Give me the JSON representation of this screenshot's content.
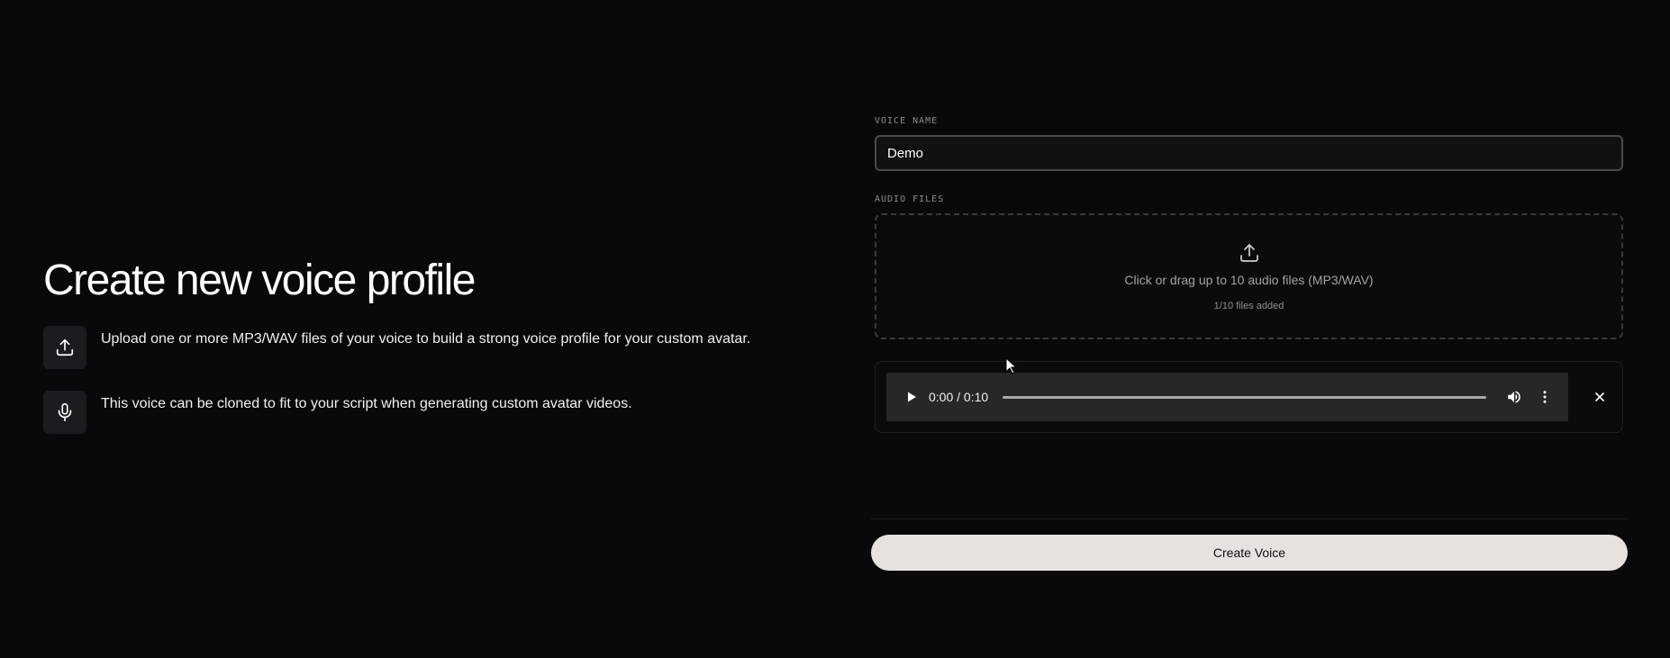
{
  "left": {
    "title": "Create new voice profile",
    "features": [
      {
        "icon": "upload-icon",
        "text": "Upload one or more MP3/WAV files of your voice to build a strong voice profile for your custom avatar."
      },
      {
        "icon": "microphone-icon",
        "text": "This voice can be cloned to fit to your script when generating custom avatar videos."
      }
    ]
  },
  "form": {
    "voice_name_label": "VOICE NAME",
    "voice_name_value": "Demo",
    "audio_files_label": "AUDIO FILES",
    "dropzone_text": "Click or drag up to 10 audio files (MP3/WAV)",
    "dropzone_count": "1/10 files added",
    "dropzone_icon": "upload-icon"
  },
  "audio_player": {
    "time": "0:00 / 0:10",
    "progress": 0,
    "icons": [
      "play-icon",
      "volume-icon",
      "more-vertical-icon",
      "close-icon"
    ]
  },
  "actions": {
    "create_label": "Create Voice"
  },
  "colors": {
    "background": "#09080b",
    "panel": "#1c1b1f",
    "button_bg": "#e5e2df",
    "button_text": "#111111"
  }
}
